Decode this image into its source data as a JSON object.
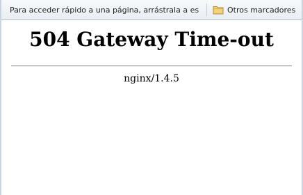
{
  "bookmarks_bar": {
    "hint_text": "Para acceder rápido a una página, arrástrala a est...",
    "other_bookmarks_label": "Otros marcadores",
    "icon": "folder-icon"
  },
  "page": {
    "title": "504 Gateway Time-out",
    "server_signature": "nginx/1.4.5"
  }
}
